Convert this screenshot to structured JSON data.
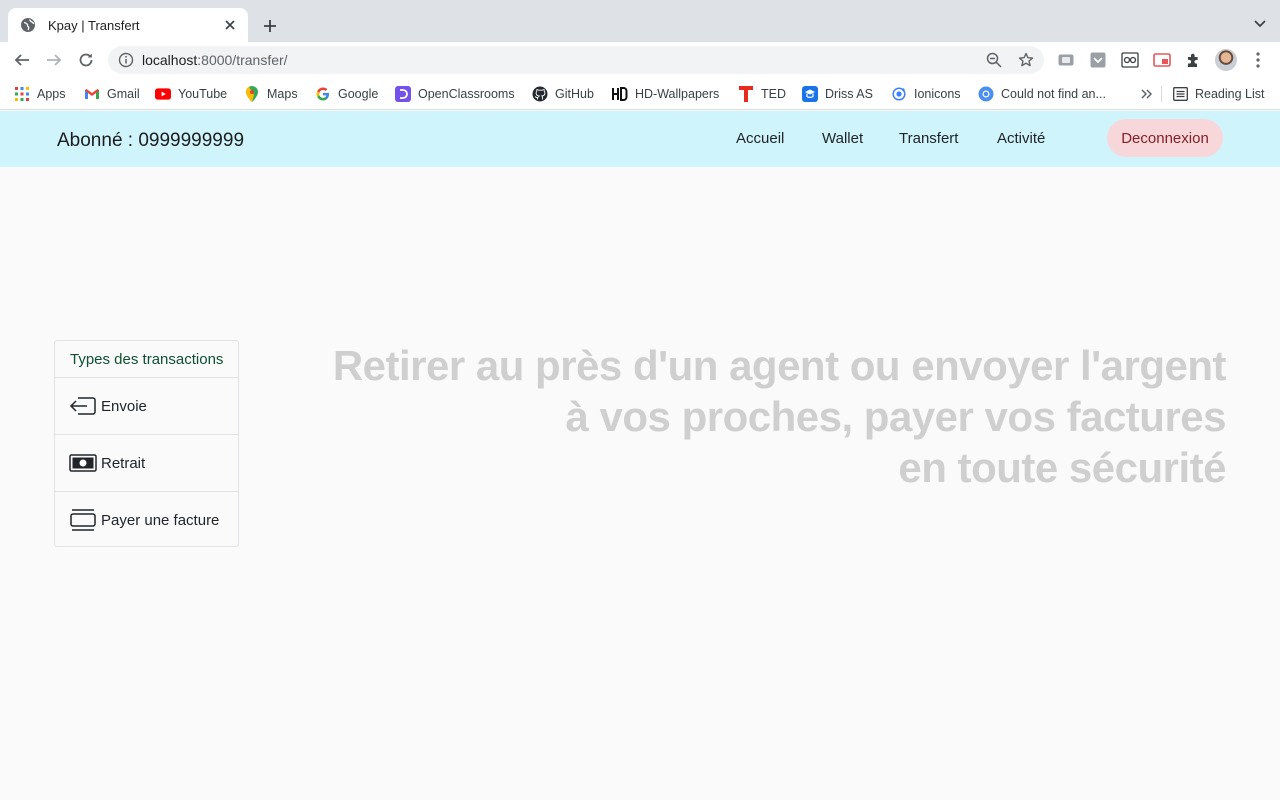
{
  "browser": {
    "tab_title": "Kpay | Transfert",
    "url_host": "localhost",
    "url_path": ":8000/transfer/",
    "bookmarks": [
      {
        "label": "Apps",
        "icon": "apps-grid-icon"
      },
      {
        "label": "Gmail",
        "icon": "gmail-icon"
      },
      {
        "label": "YouTube",
        "icon": "youtube-icon"
      },
      {
        "label": "Maps",
        "icon": "maps-icon"
      },
      {
        "label": "Google",
        "icon": "google-icon"
      },
      {
        "label": "OpenClassrooms",
        "icon": "openclassrooms-icon"
      },
      {
        "label": "GitHub",
        "icon": "github-icon"
      },
      {
        "label": "HD-Wallpapers",
        "icon": "hd-wallpapers-icon"
      },
      {
        "label": "TED",
        "icon": "ted-icon"
      },
      {
        "label": "Driss AS",
        "icon": "driss-icon"
      },
      {
        "label": "Ionicons",
        "icon": "ionicons-icon"
      },
      {
        "label": "Could not find an...",
        "icon": "chrome-page-icon"
      }
    ],
    "reading_list": "Reading List"
  },
  "navbar": {
    "subscriber": "Abonné : 0999999999",
    "links": [
      "Accueil",
      "Wallet",
      "Transfert",
      "Activité"
    ],
    "logout": "Deconnexion"
  },
  "transactions": {
    "header": "Types des transactions",
    "items": [
      {
        "label": "Envoie",
        "icon": "send-icon"
      },
      {
        "label": "Retrait",
        "icon": "cash-icon"
      },
      {
        "label": "Payer une facture",
        "icon": "bill-icon"
      }
    ]
  },
  "hero": {
    "line1": "Retirer au près d'un agent ou envoyer l'argent",
    "line2": "à vos proches, payer vos factures",
    "line3": "en toute sécurité"
  },
  "colors": {
    "navbar_bg": "#cff4fc",
    "logout_bg": "#f8d7da",
    "logout_text": "#842029",
    "header_text": "#0f5132",
    "hero_text": "#cfcfcf"
  }
}
